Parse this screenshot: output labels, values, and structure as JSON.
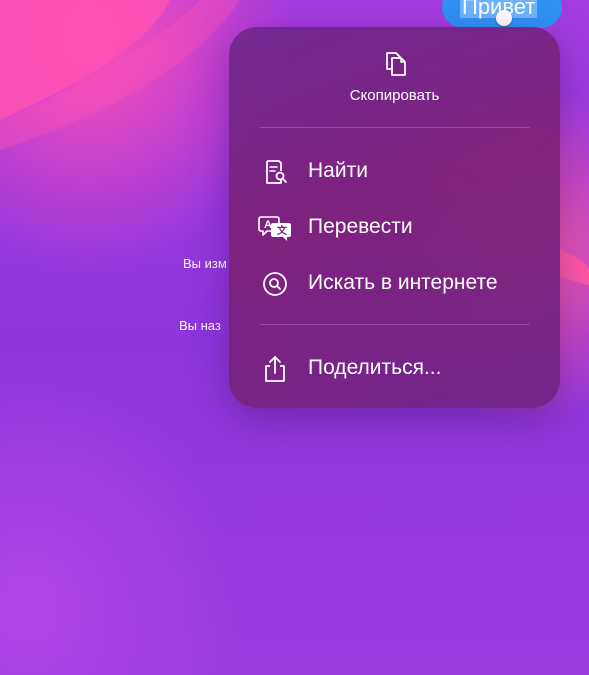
{
  "background": {
    "base_color": "#8f36dc",
    "accent_color": "#e84fc8"
  },
  "message_bubble": {
    "text": "Привет",
    "color": "#2f93f6"
  },
  "system_messages": [
    {
      "text": "Вы изм"
    },
    {
      "text": "Вы наз"
    }
  ],
  "context_menu": {
    "copy": {
      "icon": "copy-icon",
      "label": "Скопировать"
    },
    "items": [
      {
        "icon": "find-icon",
        "label": "Найти"
      },
      {
        "icon": "translate-icon",
        "label": "Перевести"
      },
      {
        "icon": "search-web-icon",
        "label": "Искать в интернете"
      }
    ],
    "share": {
      "icon": "share-icon",
      "label": "Поделиться..."
    }
  }
}
